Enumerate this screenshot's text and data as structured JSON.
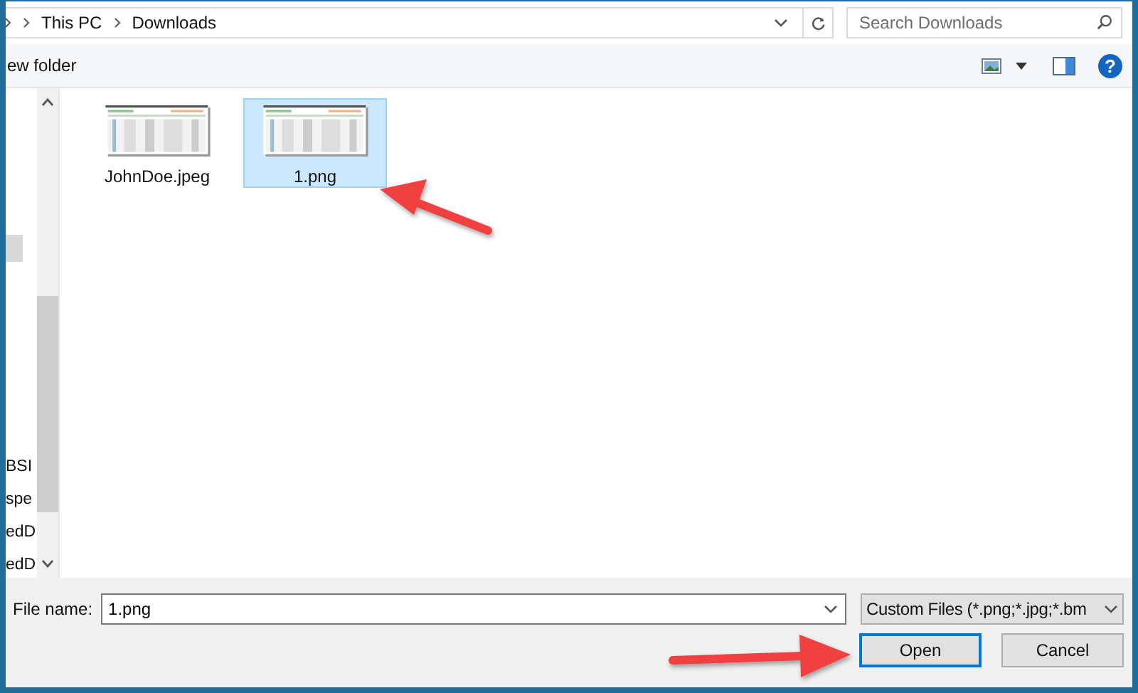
{
  "address_bar": {
    "breadcrumbs": [
      "This PC",
      "Downloads"
    ]
  },
  "search": {
    "placeholder": "Search Downloads"
  },
  "toolbar": {
    "new_folder": "ew folder",
    "help": "?"
  },
  "nav_items": [
    "BSI",
    "spe",
    "edD",
    "edD"
  ],
  "files": [
    {
      "name": "JohnDoe.jpeg",
      "selected": false
    },
    {
      "name": "1.png",
      "selected": true
    }
  ],
  "file_name": {
    "label": "File name:",
    "value": "1.png"
  },
  "file_type": {
    "value": "Custom Files (*.png;*.jpg;*.bm"
  },
  "buttons": [
    {
      "label": "Open",
      "kind": "default"
    },
    {
      "label": "Cancel",
      "kind": "normal"
    }
  ]
}
